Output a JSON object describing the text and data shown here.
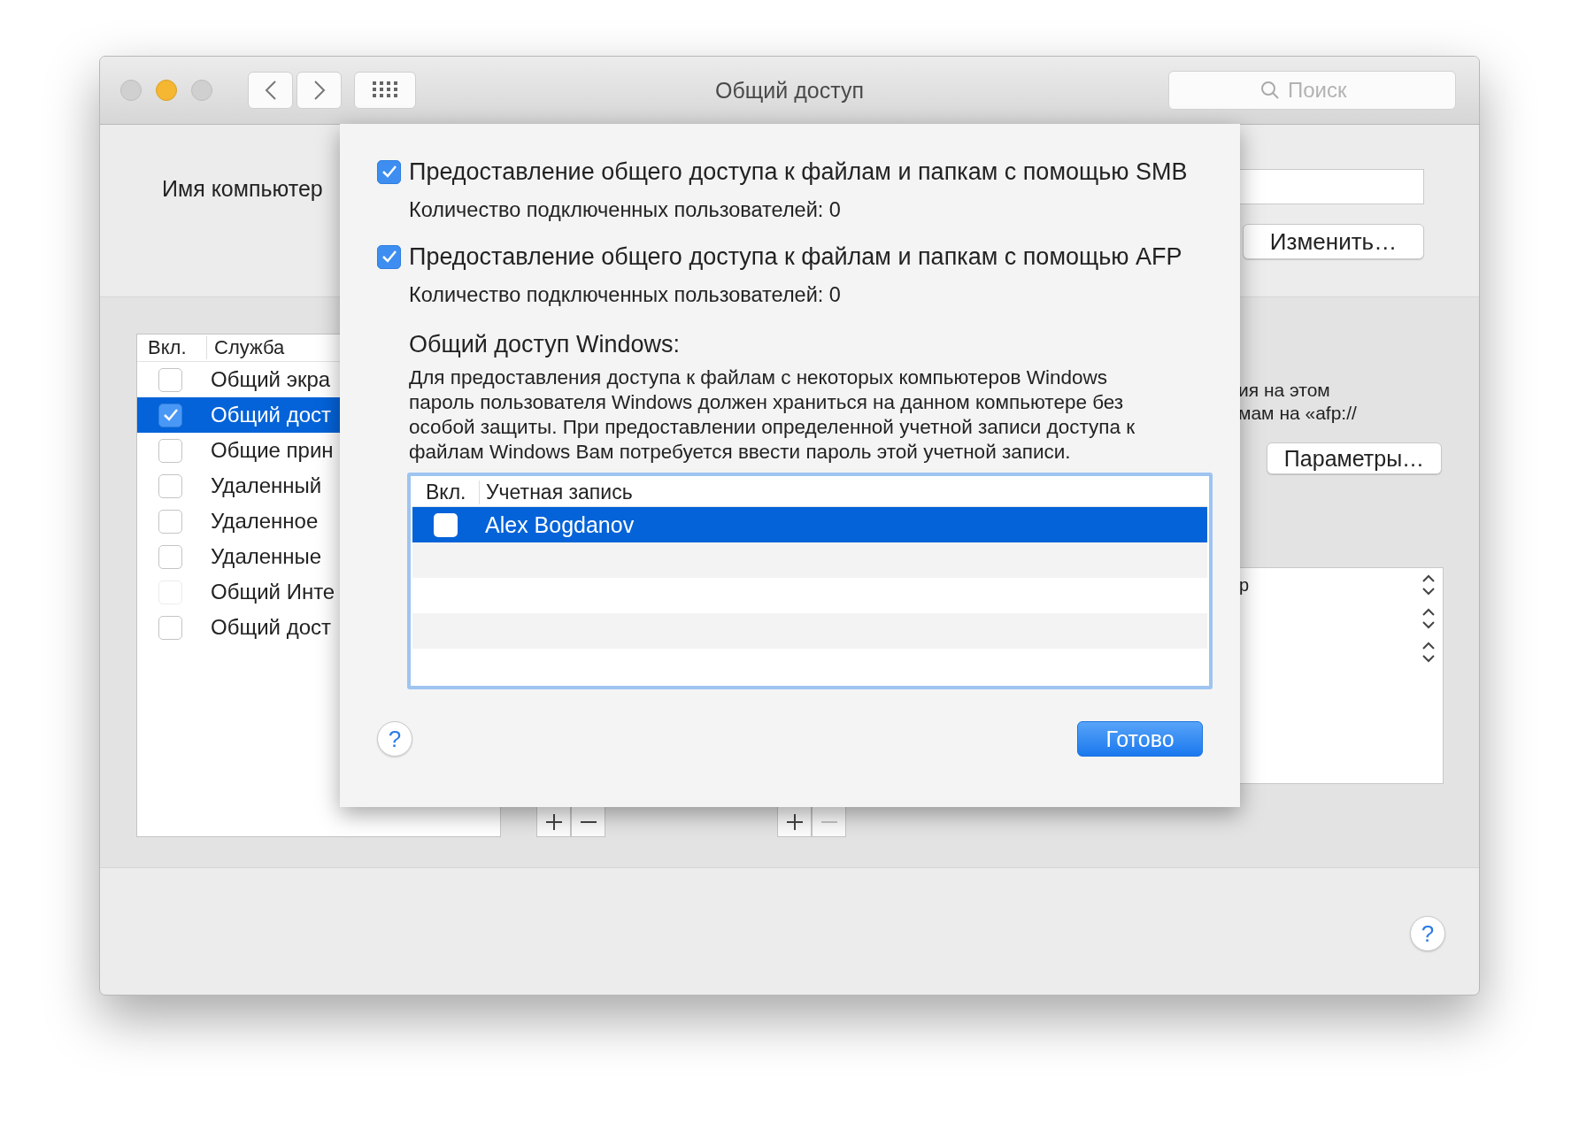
{
  "window": {
    "title": "Общий доступ"
  },
  "search": {
    "placeholder": "Поиск"
  },
  "computer_name": {
    "label": "Имя компьютер",
    "edit_button": "Изменить…"
  },
  "services": {
    "columns": [
      "Вкл.",
      "Служба"
    ],
    "items": [
      {
        "name": "Общий экра",
        "checked": false,
        "selected": false,
        "disabled": false
      },
      {
        "name": "Общий дост",
        "checked": true,
        "selected": true,
        "disabled": false
      },
      {
        "name": "Общие прин",
        "checked": false,
        "selected": false,
        "disabled": false
      },
      {
        "name": "Удаленный",
        "checked": false,
        "selected": false,
        "disabled": false
      },
      {
        "name": "Удаленное",
        "checked": false,
        "selected": false,
        "disabled": false
      },
      {
        "name": "Удаленные",
        "checked": false,
        "selected": false,
        "disabled": false
      },
      {
        "name": "Общий Инте",
        "checked": false,
        "selected": false,
        "disabled": true
      },
      {
        "name": "Общий дост",
        "checked": false,
        "selected": false,
        "disabled": false
      }
    ]
  },
  "list_buttons": [
    {
      "remove_disabled": false
    },
    {
      "remove_disabled": true
    }
  ],
  "service_details": {
    "lines": [
      "ия на этом",
      "мам на «afp://"
    ],
    "options_button": "Параметры…",
    "list_fragment": "р"
  },
  "dialog": {
    "options": [
      {
        "label": "Предоставление общего доступа к файлам и папкам с помощью SMB",
        "checked": true,
        "status": "Количество подключенных пользователей: 0"
      },
      {
        "label": "Предоставление общего доступа к файлам и папкам с помощью AFP",
        "checked": true,
        "status": "Количество подключенных пользователей: 0"
      }
    ],
    "windows_heading": "Общий доступ Windows:",
    "windows_description": "Для предоставления доступа к файлам с некоторых компьютеров Windows пароль пользователя Windows должен храниться на данном компьютере без особой защиты. При предоставлении определенной учетной записи доступа к файлам Windows Вам потребуется ввести пароль этой учетной записи.",
    "accounts": {
      "columns": [
        "Вкл.",
        "Учетная запись"
      ],
      "rows": [
        {
          "name": "Alex Bogdanov",
          "checked": false,
          "selected": true
        }
      ]
    },
    "done_button": "Готово",
    "help_button": "?"
  },
  "help_button": "?"
}
